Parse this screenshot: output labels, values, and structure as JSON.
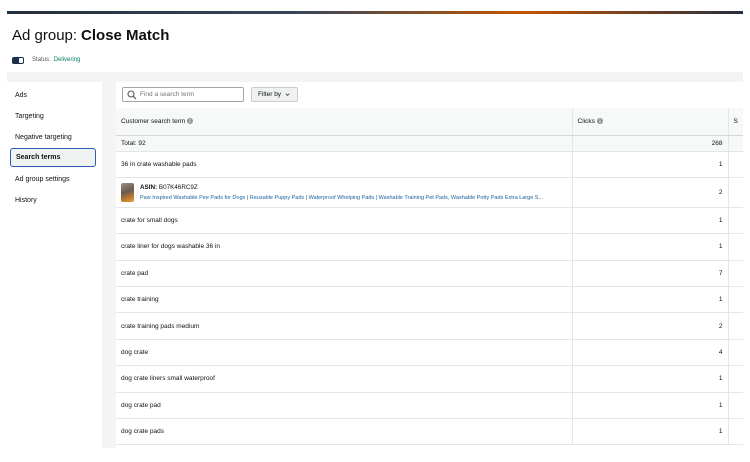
{
  "header": {
    "prefix": "Ad group:",
    "name": "Close Match",
    "status_label": "Status:",
    "status_value": "Delivering"
  },
  "sidebar": {
    "items": [
      {
        "label": "Ads"
      },
      {
        "label": "Targeting"
      },
      {
        "label": "Negative targeting"
      },
      {
        "label": "Search terms"
      },
      {
        "label": "Ad group settings"
      },
      {
        "label": "History"
      }
    ],
    "active": "Search terms"
  },
  "toolbar": {
    "search_placeholder": "Find a search term",
    "filter_label": "Filter by"
  },
  "table": {
    "columns": [
      "Customer search term",
      "Clicks",
      "S"
    ],
    "total_label": "Total: 92",
    "total_clicks": "268",
    "asin_row": {
      "asin_label": "ASIN:",
      "asin": "B07K46RC9Z",
      "product": "Paw Inspired Washable Pee Pads for Dogs | Reusable Puppy Pads | Waterproof Whelping Pads | Washable Training Pet Pads, Washable Potty Pads Extra Large S...",
      "clicks": "2"
    },
    "rows": [
      {
        "term": "36 in crate washable pads",
        "clicks": "1"
      },
      {
        "term": "crate for small dogs",
        "clicks": "1"
      },
      {
        "term": "crate liner for dogs washable 36 in",
        "clicks": "1"
      },
      {
        "term": "crate pad",
        "clicks": "7"
      },
      {
        "term": "crate training",
        "clicks": "1"
      },
      {
        "term": "crate training pads medium",
        "clicks": "2"
      },
      {
        "term": "dog crate",
        "clicks": "4"
      },
      {
        "term": "dog crate liners small waterproof",
        "clicks": "1"
      },
      {
        "term": "dog crate pad",
        "clicks": "1"
      },
      {
        "term": "dog crate pads",
        "clicks": "1"
      }
    ]
  },
  "colors": {
    "accent": "#2a5db0",
    "status": "#067d62",
    "link": "#2162a1"
  }
}
